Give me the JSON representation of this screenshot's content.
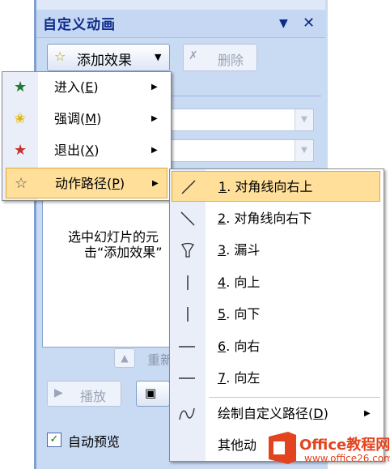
{
  "pane": {
    "title": "自定义动画",
    "add_effect_label": "添加效果",
    "delete_label": "删除",
    "instruction_line1": "选中幻灯片的元",
    "instruction_line2": "击“添加效果”",
    "reorder_label": "重新",
    "play_label": "播放",
    "autopreview_label": "自动预览"
  },
  "effect_menu": {
    "items": [
      {
        "label": "进入",
        "key": "E"
      },
      {
        "label": "强调",
        "key": "M"
      },
      {
        "label": "退出",
        "key": "X"
      },
      {
        "label": "动作路径",
        "key": "P"
      }
    ]
  },
  "path_menu": {
    "items": [
      {
        "num": "1",
        "label": ". 对角线向右上"
      },
      {
        "num": "2",
        "label": ". 对角线向右下"
      },
      {
        "num": "3",
        "label": ". 漏斗"
      },
      {
        "num": "4",
        "label": ". 向上"
      },
      {
        "num": "5",
        "label": ". 向下"
      },
      {
        "num": "6",
        "label": ". 向右"
      },
      {
        "num": "7",
        "label": ". 向左"
      }
    ],
    "custom_label": "绘制自定义路径",
    "custom_key": "D",
    "other_label": "其他动"
  },
  "watermark": {
    "title": "Office教程网",
    "url": "www.office26.com"
  },
  "colors": {
    "highlight": "#ffdf9a",
    "pane_bg": "#c9daf3",
    "title_color": "#0b2a8a"
  }
}
